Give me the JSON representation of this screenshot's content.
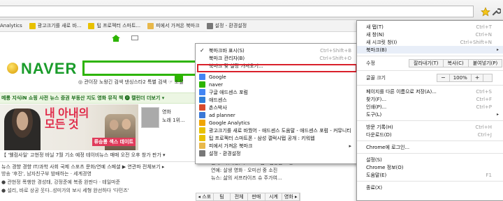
{
  "bookmarks_bar": [
    {
      "label": "Analytics",
      "color": "#f0a500"
    },
    {
      "label": "광고크기를 새로 바...",
      "color": "#e8c100"
    },
    {
      "label": "팁 프로젝터 스마트...",
      "color": "#e8c100"
    },
    {
      "label": "피에서 가져온 북마크",
      "color": "#e8b84a"
    },
    {
      "label": "설정 - 환경설정",
      "color": "#666666"
    }
  ],
  "page": {
    "logo": "NAVER",
    "gnb_links": "◎ 관이장 노왕긴 검색   댄싱스타2 특별 검색   ☞ 소설",
    "green_nav": "메롱 지식iN 쇼핑   사전 뉴스 증권 부동산 지도 영화 뮤직 책   🅡 캘린더   더보기 ▾",
    "banner_title": "내 아내의\n모든 것",
    "banner_sub": "류승룡 섹스 데이트",
    "movie_label": "영화",
    "movie_sub": "노래 1위...",
    "subline": "【 '웰컴사일' 고현정 바닐 7월 기소 예정          테이비뉴스   매매   오전   오후   창가   판가 ▾",
    "news_header": "뉴스  경향  경향  IT/과학  사회  국제  스포츠  문화/연예  스페셜   ▶   연관파 전체보기 ▸",
    "news_lines": [
      "방송 '후진', 남자친구부 밤배하는 · 세계경영",
      "● 관현정 폭행한 경성태, 강정준예 복종 완판다 · 테일마준",
      "● 설리, 바로 상공 웃다..성미가의 보시 세형 완선하다 '다민즈'"
    ],
    "right_col": [
      "연예: 나(이영)씨 프로그램 · 김동근 소통",
      "연예: 살생 영화 · 오미선 중 소진",
      "뉴스: 삶의 서프라이즈 슈 주가여..."
    ],
    "bottom_tabs": [
      "◂ 스포츠",
      "팀",
      "전체",
      "판매",
      "시계",
      "영화 ▸"
    ]
  },
  "submenu": {
    "items": [
      {
        "label": "북마크바 표시(S)",
        "shortcut": "Ctrl+Shift+B",
        "icon": "check-icon",
        "color": "#ffffff"
      },
      {
        "label": "북마크 관리자(B)",
        "shortcut": "Ctrl+Shift+O",
        "icon": "",
        "color": "#ffffff"
      },
      {
        "label": "북마크 및 설정 가져오기...",
        "shortcut": "",
        "icon": "",
        "color": "#ffffff"
      },
      {
        "label": "Google",
        "shortcut": "",
        "icon": "google-icon",
        "color": "#4285f4"
      },
      {
        "label": "naver",
        "shortcut": "",
        "icon": "naver-icon",
        "color": "#2db400"
      },
      {
        "label": "구글 애드센스 포럼",
        "shortcut": "",
        "icon": "google-icon",
        "color": "#4285f4"
      },
      {
        "label": "애드센스",
        "shortcut": "",
        "icon": "adsense-icon",
        "color": "#2f7ed8"
      },
      {
        "label": "촌스박사",
        "shortcut": "",
        "icon": "page-icon",
        "color": "#d94a2c"
      },
      {
        "label": "ad planner",
        "shortcut": "",
        "icon": "adplanner-icon",
        "color": "#3a78d6"
      },
      {
        "label": "Google Analytics",
        "shortcut": "",
        "icon": "analytics-icon",
        "color": "#f0a500"
      },
      {
        "label": "광고크기를 새로 바꿨어 - 애드센스 도움말 - 애드센스 포럼 - 커뮤니티",
        "shortcut": "",
        "icon": "page-icon",
        "color": "#e8c100"
      },
      {
        "label": "팁 프로젝터 스마트폰 - 삼성 갤럭시탭 공개 : 키워웹",
        "shortcut": "",
        "icon": "page-icon",
        "color": "#e8c100"
      },
      {
        "label": "피에서 가져온 북마크",
        "shortcut": "",
        "icon": "folder-icon",
        "color": "#e8b84a"
      },
      {
        "label": "설정 - 환경설정",
        "shortcut": "",
        "icon": "wrench-icon",
        "color": "#777777"
      }
    ]
  },
  "mainmenu": {
    "new_tab": "새 탭(T)",
    "new_tab_sc": "Ctrl+T",
    "new_window": "새 창(N)",
    "new_window_sc": "Ctrl+N",
    "incognito": "새 시크릿 창(I)",
    "incognito_sc": "Ctrl+Shift+N",
    "bookmarks": "북마크(B)",
    "edit": "수정",
    "cut": "잘라내기(T)",
    "copy": "복사(C)",
    "paste": "붙여넣기(P)",
    "zoom": "글꼴 크기",
    "zoom_minus": "−",
    "zoom_value": "100%",
    "zoom_plus": "+",
    "save_page": "페이지를 다른 이름으로 저장(A)...",
    "save_page_sc": "Ctrl+S",
    "find": "찾기(F)...",
    "find_sc": "Ctrl+F",
    "print": "인쇄(P)...",
    "print_sc": "Ctrl+P",
    "tools": "도구(L)",
    "history": "방문 기록(H)",
    "history_sc": "Ctrl+H",
    "downloads": "다운로드(D)",
    "downloads_sc": "Ctrl+J",
    "signin": "Chrome에 로그인...",
    "settings": "설정(S)",
    "about": "Chrome 정보(O)",
    "help": "도움말(E)",
    "help_sc": "F1",
    "exit": "종료(X)"
  }
}
